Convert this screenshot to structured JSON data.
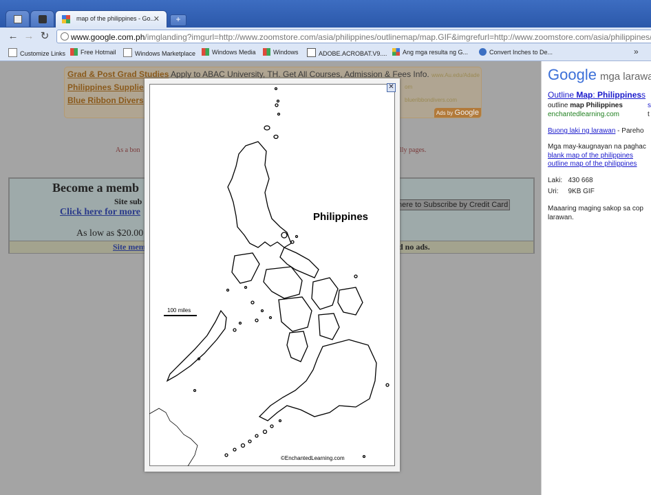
{
  "browser": {
    "tabs": [
      {
        "title": ""
      },
      {
        "title": ""
      },
      {
        "title": "map of the philippines - Go..."
      }
    ],
    "new_tab": "+",
    "url_host": "www.google.com.ph",
    "url_rest": "/imglanding?imgurl=http://www.zoomstore.com/asia/philippines/outlinemap/map.GIF&imgrefurl=http://www.zoomstore.com/asia/philippines/outline"
  },
  "bookmarks": [
    "Customize Links",
    "Free Hotmail",
    "Windows Marketplace",
    "Windows Media",
    "Windows",
    "ADOBE.ACROBAT.V9....",
    "Ang mga resulta ng G...",
    "Convert Inches to De..."
  ],
  "bookmarks_more": "»",
  "ads": [
    {
      "link": "Grad & Post Grad Studies",
      "desc": "Apply to ABAC University, TH. Get All Courses, Admission & Fees Info.",
      "url": "www.Au.edu/Adade"
    },
    {
      "link": "Philippines Supplie",
      "desc": "",
      "url": "om"
    },
    {
      "link": "Blue Ribbon Divers",
      "desc": "",
      "url": "blueribbondivers.com"
    }
  ],
  "ads_by": "Ads by",
  "ads_by_brand": "Google",
  "bonus_left": "As a bon",
  "bonus_right": "lly pages.",
  "membership": {
    "title": "Become a memb",
    "sub": "Site sub",
    "click": "Click here for more",
    "low": "As low as $20.00",
    "subscribe_btn": "here to Subscribe by Credit Card",
    "site_mem": "Site mem",
    "no_ads": "d no ads."
  },
  "sidebar": {
    "logo": "Google",
    "logo_sub": "mga larawa",
    "title_pre": "Outline ",
    "title_bold": "Map",
    "title_sep": ": ",
    "title_bold2": "Philippines",
    "title_post": "s",
    "subtitle_pre": "outline ",
    "subtitle_bold": "map Philippines",
    "source": "enchantedlearning.com",
    "full_size_link": "Buong laki ng larawan",
    "full_size_rest": " - Pareho",
    "related_label": "Mga may-kaugnayan na paghac",
    "related": [
      "blank map of the philippines",
      "outline map of the philippines"
    ],
    "size_label": "Laki:",
    "size_value": "430  668",
    "type_label": "Uri:",
    "type_value": "9KB GIF",
    "note1": "Maaaring maging sakop sa cop",
    "note2": "larawan.",
    "edge_marks": [
      "s",
      "t"
    ]
  },
  "lightbox": {
    "close": "✕",
    "map_label": "Philippines",
    "scale_label": "100 miles",
    "credit": "©EnchantedLearning.com"
  }
}
